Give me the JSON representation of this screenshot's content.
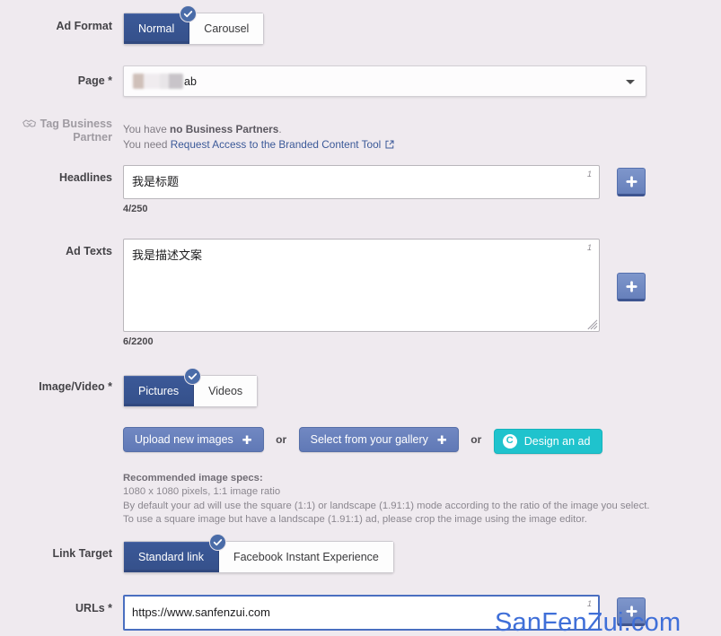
{
  "form": {
    "ad_format": {
      "label": "Ad Format",
      "options": [
        "Normal",
        "Carousel"
      ],
      "selected": "Normal"
    },
    "page": {
      "label": "Page *",
      "value_suffix": "ab",
      "redacted": true
    },
    "tag_business_partner": {
      "label_line1": "Tag Business",
      "label_line2": "Partner",
      "icon": "handshake-icon",
      "notice_line1_prefix": "You have ",
      "notice_line1_strong": "no Business Partners",
      "notice_line1_suffix": ".",
      "notice_line2_prefix": "You need ",
      "notice_line2_link": "Request Access to the Branded Content Tool",
      "external_icon": "external-link-icon"
    },
    "headlines": {
      "label": "Headlines",
      "value": "我是标题",
      "counter": "4/250",
      "index_marker": "1",
      "add_button": "add-headline-button"
    },
    "ad_texts": {
      "label": "Ad Texts",
      "value": "我是描述文案",
      "counter": "6/2200",
      "index_marker": "1",
      "add_button": "add-ad-text-button"
    },
    "image_video": {
      "label": "Image/Video *",
      "options": [
        "Pictures",
        "Videos"
      ],
      "selected": "Pictures",
      "upload_button": "Upload new images",
      "or_1": "or",
      "gallery_button": "Select from your gallery",
      "or_2": "or",
      "design_button": "Design an ad",
      "design_icon_letter": "C",
      "specs_title": "Recommended image specs:",
      "specs_line1": "1080 x 1080 pixels, 1:1 image ratio",
      "specs_line2": "By default your ad will use the square (1:1) or landscape (1.91:1) mode according to the ratio of the image you select.",
      "specs_line3": "To use a square image but have a landscape (1.91:1) ad, please crop the image using the image editor."
    },
    "link_target": {
      "label": "Link Target",
      "options": [
        "Standard link",
        "Facebook Instant Experience"
      ],
      "selected": "Standard link"
    },
    "urls": {
      "label": "URLs *",
      "value": "https://www.sanfenzui.com",
      "index_marker": "1",
      "add_button": "add-url-button"
    }
  },
  "watermark": {
    "text": "SanFenZui.com"
  },
  "colors": {
    "background": "#efeaef",
    "accent_blue": "#3b5998",
    "button_blue": "#6780bb",
    "link_blue": "#3b5998",
    "canva_teal": "#1fc3cd",
    "watermark_blue": "#3f6fd8"
  }
}
